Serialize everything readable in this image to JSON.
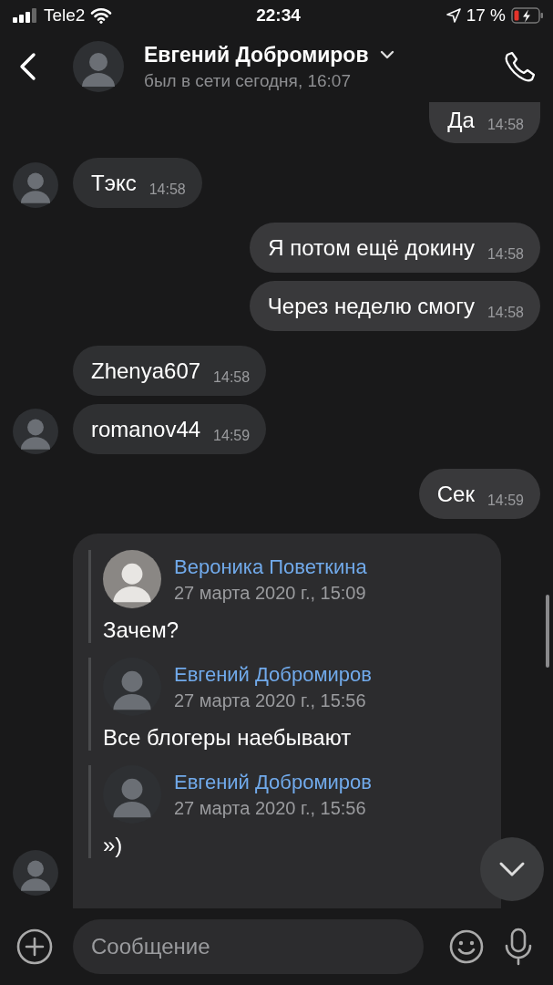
{
  "status_bar": {
    "carrier": "Tele2",
    "time": "22:34",
    "battery": "17 %"
  },
  "header": {
    "name": "Евгений Добромиров",
    "status": "был в сети сегодня, 16:07"
  },
  "messages": [
    {
      "kind": "text",
      "outgoing": true,
      "text": "Да",
      "time": "14:58",
      "avatar": false
    },
    {
      "kind": "text",
      "outgoing": false,
      "text": "Тэкс",
      "time": "14:58",
      "avatar": true
    },
    {
      "kind": "text",
      "outgoing": true,
      "text": "Я потом ещё докину",
      "time": "14:58",
      "avatar": false
    },
    {
      "kind": "text",
      "outgoing": true,
      "text": "Через неделю смогу",
      "time": "14:58",
      "avatar": false
    },
    {
      "kind": "text",
      "outgoing": false,
      "text": "Zhenya607",
      "time": "14:58",
      "avatar": false
    },
    {
      "kind": "text",
      "outgoing": false,
      "text": "romanov44",
      "time": "14:59",
      "avatar": true
    },
    {
      "kind": "text",
      "outgoing": true,
      "text": "Сек",
      "time": "14:59",
      "avatar": false
    },
    {
      "kind": "forward",
      "outgoing": false,
      "avatar": true,
      "items": [
        {
          "name": "Вероника Поветкина",
          "date": "27 марта 2020 г., 15:09",
          "text": "Зачем?"
        },
        {
          "name": "Евгений Добромиров",
          "date": "27 марта 2020 г., 15:56",
          "text": "Все блогеры наебывают"
        },
        {
          "name": "Евгений Добромиров",
          "date": "27 марта 2020 г., 15:56",
          "text": "»)"
        }
      ]
    }
  ],
  "composer": {
    "placeholder": "Сообщение"
  }
}
